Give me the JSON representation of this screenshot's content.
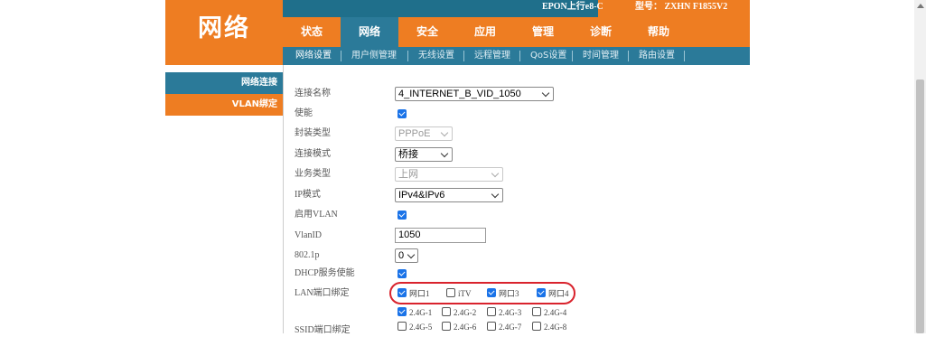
{
  "brand": {
    "title": "网络"
  },
  "topbar": {
    "epon": "EPON上行e8-C",
    "model": "型号： ZXHN F1855V2"
  },
  "mainnav": {
    "tabs": [
      "状态",
      "网络",
      "安全",
      "应用",
      "管理",
      "诊断",
      "帮助"
    ],
    "active": "网络"
  },
  "subnav": {
    "items": [
      "网络设置",
      "用户侧管理",
      "无线设置",
      "远程管理",
      "QoS设置",
      "时间管理",
      "路由设置"
    ]
  },
  "sidebar": {
    "items": [
      "网络连接",
      "VLAN绑定"
    ]
  },
  "form": {
    "labels": {
      "connection_name": "连接名称",
      "enable": "使能",
      "encap_type": "封装类型",
      "connection_mode": "连接模式",
      "service_type": "业务类型",
      "ip_mode": "IP模式",
      "enable_vlan": "启用VLAN",
      "vlan_id": "VlanID",
      "dot1p": "802.1p",
      "dhcp_enable": "DHCP服务使能",
      "lan_binding": "LAN端口绑定",
      "ssid_binding": "SSID端口绑定"
    },
    "connection_name_value": "4_INTERNET_B_VID_1050",
    "enable_checked": true,
    "encap_type_value": "PPPoE",
    "connection_mode_value": "桥接",
    "service_type_value": "上网",
    "ip_mode_value": "IPv4&IPv6",
    "enable_vlan_checked": true,
    "vlan_id_value": "1050",
    "dot1p_value": "0",
    "dhcp_enable_checked": true,
    "lan_ports": [
      {
        "label": "网口1",
        "checked": true
      },
      {
        "label": "iTV",
        "checked": false
      },
      {
        "label": "网口3",
        "checked": true
      },
      {
        "label": "网口4",
        "checked": true
      }
    ],
    "ssid_ports": [
      {
        "label": "2.4G-1",
        "checked": true
      },
      {
        "label": "2.4G-2",
        "checked": false
      },
      {
        "label": "2.4G-3",
        "checked": false
      },
      {
        "label": "2.4G-4",
        "checked": false
      },
      {
        "label": "2.4G-5",
        "checked": false
      },
      {
        "label": "2.4G-6",
        "checked": false
      },
      {
        "label": "2.4G-7",
        "checked": false
      },
      {
        "label": "2.4G-8",
        "checked": false
      }
    ]
  },
  "colors": {
    "orange": "#ee7d22",
    "teal": "#2b7a99",
    "annotation_red": "#d9232d"
  }
}
